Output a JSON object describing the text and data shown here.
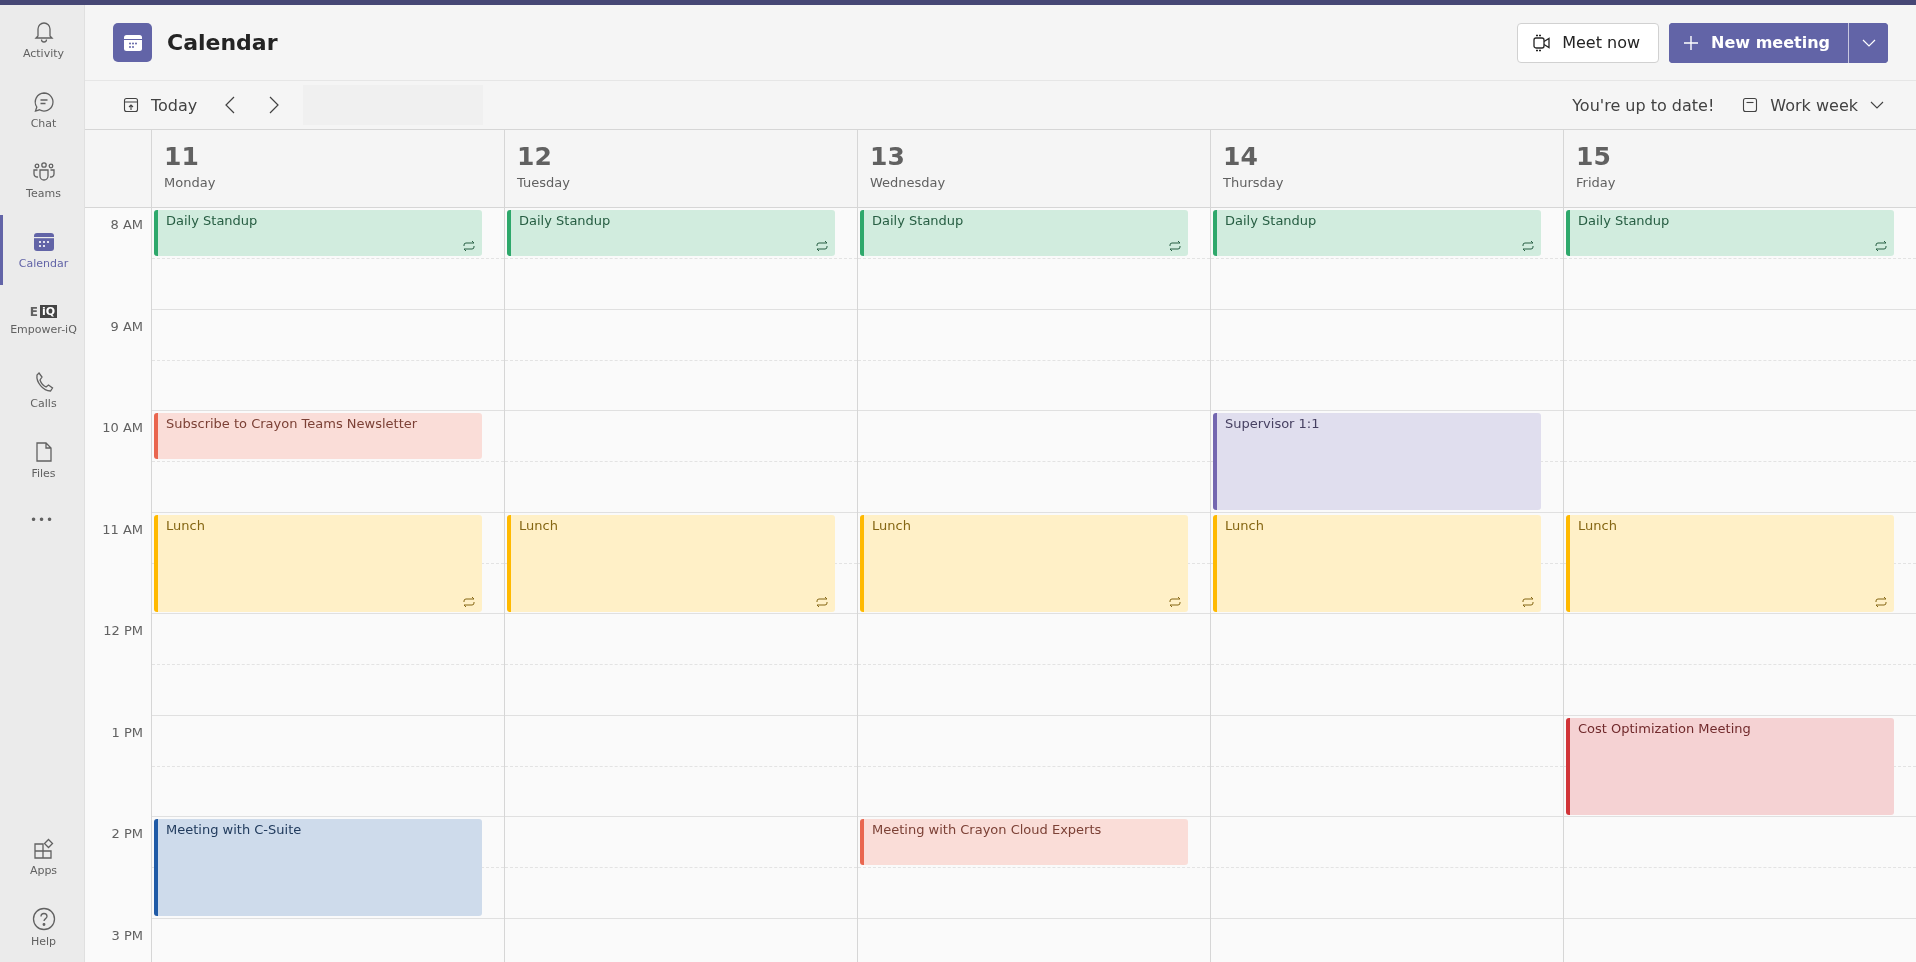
{
  "sidebar": {
    "items": [
      {
        "kind": "activity",
        "label": "Activity",
        "selected": false
      },
      {
        "kind": "chat",
        "label": "Chat",
        "selected": false
      },
      {
        "kind": "teams",
        "label": "Teams",
        "selected": false
      },
      {
        "kind": "calendar",
        "label": "Calendar",
        "selected": true
      },
      {
        "kind": "app",
        "label": "Empower-iQ",
        "selected": false,
        "icon_prefix": "E",
        "icon_text": "iQ"
      },
      {
        "kind": "calls",
        "label": "Calls",
        "selected": false
      },
      {
        "kind": "files",
        "label": "Files",
        "selected": false
      },
      {
        "kind": "more",
        "label": "•••",
        "selected": false
      }
    ],
    "bottom_items": [
      {
        "kind": "apps",
        "label": "Apps",
        "selected": false
      },
      {
        "kind": "help",
        "label": "Help",
        "selected": false
      }
    ]
  },
  "header": {
    "title": "Calendar",
    "meet_now": "Meet now",
    "new_meeting": "New meeting"
  },
  "toolbar": {
    "today": "Today",
    "status": "You're up to date!",
    "view": "Work week"
  },
  "time_labels": [
    "8 AM",
    "9 AM",
    "10 AM",
    "11 AM",
    "12 PM",
    "1 PM",
    "2 PM",
    "3 PM"
  ],
  "days": [
    {
      "date": "11",
      "weekday": "Monday",
      "cells": [
        {
          "kind": "event",
          "event": {
            "title": "Daily Standup",
            "kind": "half",
            "color": "#2ea86b",
            "recurring": true
          }
        },
        {
          "kind": "empty"
        },
        {
          "kind": "event",
          "event": {
            "title": "Subscribe to Crayon Teams Newsletter",
            "kind": "half",
            "color": "#e9664f",
            "recurring": false
          }
        },
        {
          "kind": "event",
          "event": {
            "title": "Lunch",
            "kind": "hour",
            "color": "#ffb900",
            "recurring": true
          }
        },
        {
          "kind": "empty"
        },
        {
          "kind": "empty"
        },
        {
          "kind": "event",
          "event": {
            "title": "Meeting with C-Suite",
            "kind": "hour",
            "color": "#1f5aa6",
            "recurring": false
          }
        },
        {
          "kind": "empty"
        }
      ]
    },
    {
      "date": "12",
      "weekday": "Tuesday",
      "cells": [
        {
          "kind": "event",
          "event": {
            "title": "Daily Standup",
            "kind": "half",
            "color": "#2ea86b",
            "recurring": true
          }
        },
        {
          "kind": "empty"
        },
        {
          "kind": "empty"
        },
        {
          "kind": "event",
          "event": {
            "title": "Lunch",
            "kind": "hour",
            "color": "#ffb900",
            "recurring": true
          }
        },
        {
          "kind": "empty"
        },
        {
          "kind": "empty"
        },
        {
          "kind": "empty"
        },
        {
          "kind": "empty"
        }
      ]
    },
    {
      "date": "13",
      "weekday": "Wednesday",
      "cells": [
        {
          "kind": "event",
          "event": {
            "title": "Daily Standup",
            "kind": "half",
            "color": "#2ea86b",
            "recurring": true
          }
        },
        {
          "kind": "empty"
        },
        {
          "kind": "empty"
        },
        {
          "kind": "event",
          "event": {
            "title": "Lunch",
            "kind": "hour",
            "color": "#ffb900",
            "recurring": true
          }
        },
        {
          "kind": "empty"
        },
        {
          "kind": "empty"
        },
        {
          "kind": "event",
          "event": {
            "title": "Meeting with Crayon Cloud Experts",
            "kind": "half",
            "color": "#e9664f",
            "recurring": false
          }
        },
        {
          "kind": "empty"
        }
      ]
    },
    {
      "date": "14",
      "weekday": "Thursday",
      "cells": [
        {
          "kind": "event",
          "event": {
            "title": "Daily Standup",
            "kind": "half",
            "color": "#2ea86b",
            "recurring": true
          }
        },
        {
          "kind": "empty"
        },
        {
          "kind": "event",
          "event": {
            "title": "Supervisor 1:1",
            "kind": "hour",
            "color": "#7467b0",
            "recurring": false
          }
        },
        {
          "kind": "event",
          "event": {
            "title": "Lunch",
            "kind": "hour",
            "color": "#ffb900",
            "recurring": true
          }
        },
        {
          "kind": "empty"
        },
        {
          "kind": "empty"
        },
        {
          "kind": "empty"
        },
        {
          "kind": "empty"
        }
      ]
    },
    {
      "date": "15",
      "weekday": "Friday",
      "cells": [
        {
          "kind": "event",
          "event": {
            "title": "Daily Standup",
            "kind": "half",
            "color": "#2ea86b",
            "recurring": true
          }
        },
        {
          "kind": "empty"
        },
        {
          "kind": "empty"
        },
        {
          "kind": "event",
          "event": {
            "title": "Lunch",
            "kind": "hour",
            "color": "#ffb900",
            "recurring": true
          }
        },
        {
          "kind": "empty"
        },
        {
          "kind": "event",
          "event": {
            "title": "Cost Optimization Meeting",
            "kind": "hour",
            "color": "#d13438",
            "recurring": false
          }
        },
        {
          "kind": "empty"
        },
        {
          "kind": "empty"
        }
      ]
    }
  ]
}
